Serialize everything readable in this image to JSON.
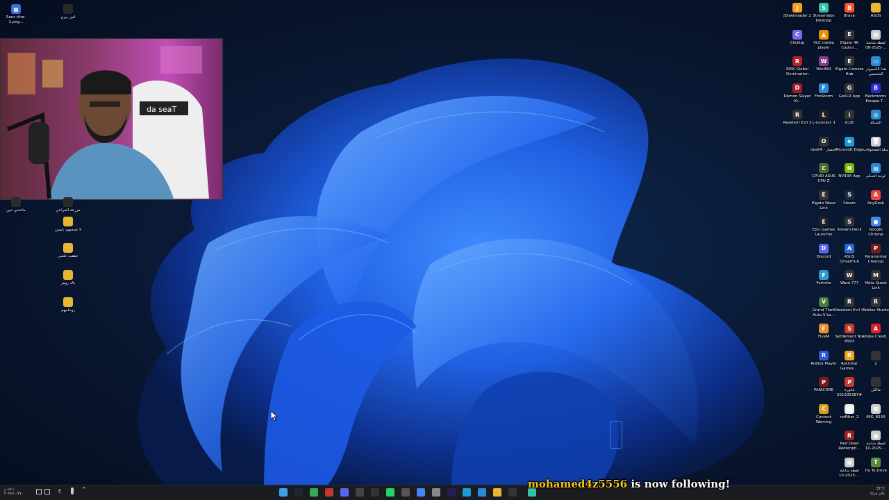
{
  "desktop": {
    "left_icons": [
      {
        "label": "Sans titre-1.png...",
        "color": "#3a6fd8",
        "glyph": "▦"
      },
      {
        "label": "لتين بيرم",
        "color": "#2a2a2a",
        "glyph": ""
      },
      {
        "label": "ماعندي تتين",
        "color": "#2a2a2a",
        "glyph": ""
      },
      {
        "label": "مزرعة المراعي",
        "color": "#2a2a2a",
        "glyph": ""
      },
      {
        "label": "لا تصحيهم نايمين",
        "color": "#e8b634",
        "glyph": ""
      },
      {
        "label": "حققت حلمي",
        "color": "#e8b634",
        "glyph": ""
      },
      {
        "label": "باك رومر",
        "color": "#e8b634",
        "glyph": ""
      },
      {
        "label": "روحانيهم",
        "color": "#e8b634",
        "glyph": ""
      }
    ],
    "right_col1": [
      {
        "label": "JDownloader 2",
        "color": "#f2a31b",
        "glyph": "J"
      },
      {
        "label": "ClickUp",
        "color": "#7b68ee",
        "glyph": "C"
      },
      {
        "label": "RISK Global Domination",
        "color": "#b22222",
        "glyph": "R"
      },
      {
        "label": "Demon Slayer -Ki...",
        "color": "#a02020",
        "glyph": "D"
      },
      {
        "label": "Resident Evil 3",
        "color": "#333333",
        "glyph": "R"
      }
    ],
    "right_col2": [
      {
        "label": "Streamlabs Desktop",
        "color": "#31c3a2",
        "glyph": "S"
      },
      {
        "label": "VLC media player",
        "color": "#f08c00",
        "glyph": "▲"
      },
      {
        "label": "WinRAR",
        "color": "#8b3a8b",
        "glyph": "W"
      },
      {
        "label": "FireStorm",
        "color": "#2a8ad4",
        "glyph": "F"
      },
      {
        "label": "L-Connect 3",
        "color": "#222222",
        "glyph": "L"
      },
      {
        "label": "obs64 - اختصار",
        "color": "#333333",
        "glyph": "O"
      },
      {
        "label": "CPUID ASUS CPU-Z",
        "color": "#4a6a2a",
        "glyph": "C"
      },
      {
        "label": "Elgato Wave Link",
        "color": "#333333",
        "glyph": "E"
      },
      {
        "label": "Epic Games Launcher",
        "color": "#222222",
        "glyph": "E"
      },
      {
        "label": "Discord",
        "color": "#5865f2",
        "glyph": "D"
      },
      {
        "label": "Fortnite",
        "color": "#2a9ad4",
        "glyph": "F"
      },
      {
        "label": "Grand Theft Auto V Le...",
        "color": "#4a7a3a",
        "glyph": "V"
      },
      {
        "label": "FiveM",
        "color": "#f08c2a",
        "glyph": "F"
      },
      {
        "label": "Roblox Player",
        "color": "#2a5ad4",
        "glyph": "R"
      },
      {
        "label": "PANICORE",
        "color": "#7a1a1a",
        "glyph": "P"
      },
      {
        "label": "Content Warning",
        "color": "#d4a01a",
        "glyph": "C"
      }
    ],
    "right_col3": [
      {
        "label": "Brave",
        "color": "#fb542b",
        "glyph": "B"
      },
      {
        "label": "Elgato 4K Captur...",
        "color": "#333333",
        "glyph": "E"
      },
      {
        "label": "Elgato Camera Hub",
        "color": "#333333",
        "glyph": "E"
      },
      {
        "label": "GoXLR App",
        "color": "#333333",
        "glyph": "G"
      },
      {
        "label": "iCUE",
        "color": "#333333",
        "glyph": "i"
      },
      {
        "label": "Microsoft Edge",
        "color": "#1f9ad6",
        "glyph": "e"
      },
      {
        "label": "NVIDIA App",
        "color": "#76b900",
        "glyph": "N"
      },
      {
        "label": "Steam",
        "color": "#1b2838",
        "glyph": "S"
      },
      {
        "label": "Stream Deck",
        "color": "#333333",
        "glyph": "S"
      },
      {
        "label": "ASUS DriverHub",
        "color": "#2a6ad4",
        "glyph": "A"
      },
      {
        "label": "Ward 777",
        "color": "#333333",
        "glyph": "W"
      },
      {
        "label": "Resident Evil 4",
        "color": "#333333",
        "glyph": "R"
      },
      {
        "label": "Settlement No. 8993",
        "color": "#c0392b",
        "glyph": "S"
      },
      {
        "label": "Rockstar Games ...",
        "color": "#f2a31b",
        "glyph": "R"
      },
      {
        "label": "فاتورة #201635387",
        "color": "#c0392b",
        "glyph": "P"
      },
      {
        "label": "noFilter_2",
        "color": "#eeeeee",
        "glyph": "▦"
      },
      {
        "label": "Red Dead Redempti...",
        "color": "#a02020",
        "glyph": "R"
      },
      {
        "label": "لقطة شاشة 2025-10-...",
        "color": "#cccccc",
        "glyph": "▦"
      }
    ],
    "right_col4": [
      {
        "label": "ASUS",
        "color": "#e8b634",
        "glyph": ""
      },
      {
        "label": "لقطة شاشة 2025-08-...",
        "color": "#cccccc",
        "glyph": "▦"
      },
      {
        "label": "هذا الكمبيوتر الشخصي",
        "color": "#2a8ad4",
        "glyph": "▭"
      },
      {
        "label": "Backrooms Escape T...",
        "color": "#2a2ad4",
        "glyph": "B"
      },
      {
        "label": "الشبكة",
        "color": "#2a8ad4",
        "glyph": "◎"
      },
      {
        "label": "سلة المحذوفات",
        "color": "#cccccc",
        "glyph": "🗑"
      },
      {
        "label": "لوحة التحكم",
        "color": "#2a8ad4",
        "glyph": "▤"
      },
      {
        "label": "AnyDesk",
        "color": "#ef443b",
        "glyph": "A"
      },
      {
        "label": "Google Chrome",
        "color": "#4285f4",
        "glyph": "●"
      },
      {
        "label": "Paranormal Cleanup",
        "color": "#7a1a1a",
        "glyph": "P"
      },
      {
        "label": "Meta Quest Link",
        "color": "#333333",
        "glyph": "M"
      },
      {
        "label": "Roblox Studio",
        "color": "#333333",
        "glyph": "R"
      },
      {
        "label": "Adobe Creati...",
        "color": "#da1f26",
        "glyph": "A"
      },
      {
        "label": "2",
        "color": "#333333",
        "glyph": ""
      },
      {
        "label": "مالكي",
        "color": "#333333",
        "glyph": ""
      },
      {
        "label": "IMG_8330",
        "color": "#cccccc",
        "glyph": "▦"
      },
      {
        "label": "لقطة شاشة 2025-10-...",
        "color": "#cccccc",
        "glyph": "▦"
      },
      {
        "label": "Try To Drive",
        "color": "#5a8a3a",
        "glyph": "T"
      }
    ]
  },
  "webcam": {
    "chair_text": "da seaT"
  },
  "taskbar": {
    "icons": [
      {
        "name": "start-icon",
        "color": "#3aa0e8"
      },
      {
        "name": "steam-icon",
        "color": "#1b2838"
      },
      {
        "name": "chrome-icon",
        "color": "#34a853"
      },
      {
        "name": "obs-icon",
        "color": "#c0392b"
      },
      {
        "name": "discord-icon",
        "color": "#5865f2"
      },
      {
        "name": "xbox-icon",
        "color": "#444444"
      },
      {
        "name": "epic-icon",
        "color": "#333333"
      },
      {
        "name": "whatsapp-icon",
        "color": "#25d366"
      },
      {
        "name": "settings-icon",
        "color": "#555555"
      },
      {
        "name": "chrome-icon-2",
        "color": "#4285f4"
      },
      {
        "name": "file-icon",
        "color": "#888888"
      },
      {
        "name": "premiere-icon",
        "color": "#2a1a5a"
      },
      {
        "name": "edge-icon",
        "color": "#1f9ad6"
      },
      {
        "name": "store-icon",
        "color": "#2a8ad4"
      },
      {
        "name": "explorer-icon",
        "color": "#e8b634"
      },
      {
        "name": "app-icon",
        "color": "#333333"
      },
      {
        "name": "streamlabs-icon",
        "color": "#31c3a2"
      }
    ],
    "tray_left_text": "٤٥:١٠ م\n٢٠٢٥/١٠/٢٧",
    "tray_right_temp": "31°C",
    "tray_right_text": "غائم جزئيًا"
  },
  "alert": {
    "user": "mohamed4z5556",
    "message": " is now following!"
  }
}
